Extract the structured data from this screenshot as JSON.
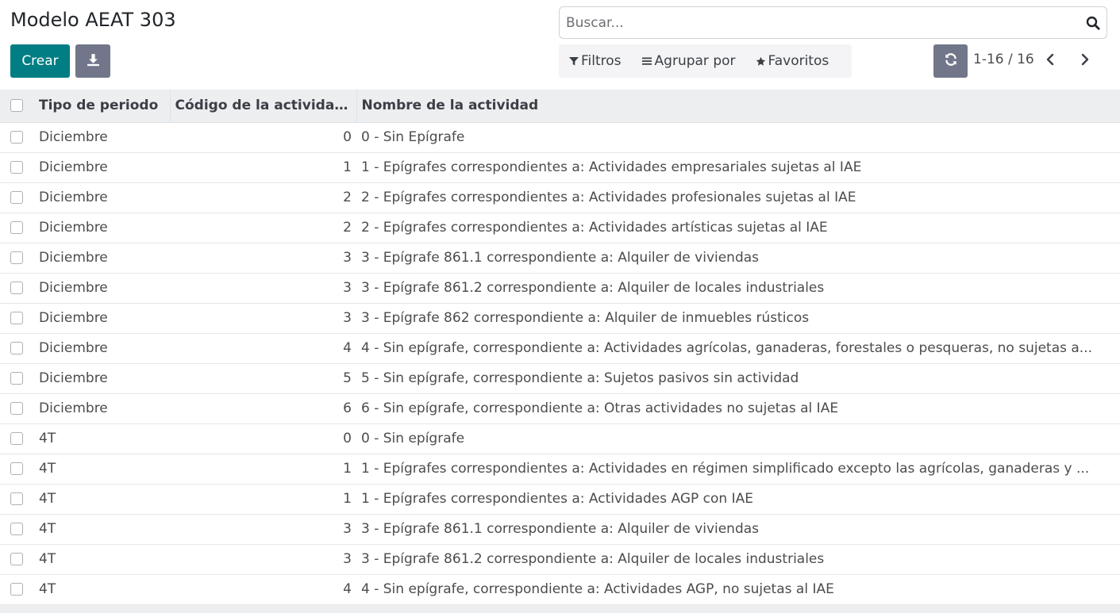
{
  "page": {
    "title": "Modelo AEAT 303"
  },
  "toolbar": {
    "create_label": "Crear",
    "download_icon": "download-icon",
    "refresh_icon": "refresh-icon"
  },
  "search": {
    "placeholder": "Buscar..."
  },
  "filters": {
    "filters_label": "Filtros",
    "group_by_label": "Agrupar por",
    "favorites_label": "Favoritos"
  },
  "pager": {
    "value": "1-16 / 16"
  },
  "colors": {
    "primary": "#017e84",
    "secondary": "#71768a"
  },
  "table": {
    "headers": [
      "Tipo de periodo",
      "Código de la actividad...",
      "Nombre de la actividad"
    ],
    "rows": [
      {
        "tipo": "Diciembre",
        "codigo": "0",
        "nombre": "0 - Sin Epígrafe"
      },
      {
        "tipo": "Diciembre",
        "codigo": "1",
        "nombre": "1 - Epígrafes correspondientes a: Actividades empresariales sujetas al IAE"
      },
      {
        "tipo": "Diciembre",
        "codigo": "2",
        "nombre": "2 - Epígrafes correspondientes a: Actividades profesionales sujetas al IAE"
      },
      {
        "tipo": "Diciembre",
        "codigo": "2",
        "nombre": "2 - Epígrafes correspondientes a: Actividades artísticas sujetas al IAE"
      },
      {
        "tipo": "Diciembre",
        "codigo": "3",
        "nombre": "3 - Epígrafe 861.1 correspondiente a: Alquiler de viviendas"
      },
      {
        "tipo": "Diciembre",
        "codigo": "3",
        "nombre": "3 - Epígrafe 861.2 correspondiente a: Alquiler de locales industriales"
      },
      {
        "tipo": "Diciembre",
        "codigo": "3",
        "nombre": "3 - Epígrafe 862 correspondiente a: Alquiler de inmuebles rústicos"
      },
      {
        "tipo": "Diciembre",
        "codigo": "4",
        "nombre": "4 - Sin epígrafe, correspondiente a: Actividades agrícolas, ganaderas, forestales o pesqueras, no sujetas a..."
      },
      {
        "tipo": "Diciembre",
        "codigo": "5",
        "nombre": "5 - Sin epígrafe, correspondiente a: Sujetos pasivos sin actividad"
      },
      {
        "tipo": "Diciembre",
        "codigo": "6",
        "nombre": "6 - Sin epígrafe, correspondiente a: Otras actividades no sujetas al IAE"
      },
      {
        "tipo": "4T",
        "codigo": "0",
        "nombre": "0 - Sin epígrafe"
      },
      {
        "tipo": "4T",
        "codigo": "1",
        "nombre": "1 - Epígrafes correspondientes a: Actividades en régimen simplificado excepto las agrícolas, ganaderas y ..."
      },
      {
        "tipo": "4T",
        "codigo": "1",
        "nombre": "1 - Epígrafes correspondientes a: Actividades AGP con IAE"
      },
      {
        "tipo": "4T",
        "codigo": "3",
        "nombre": "3 - Epígrafe 861.1 correspondiente a: Alquiler de viviendas"
      },
      {
        "tipo": "4T",
        "codigo": "3",
        "nombre": "3 - Epígrafe 861.2 correspondiente a: Alquiler de locales industriales"
      },
      {
        "tipo": "4T",
        "codigo": "4",
        "nombre": "4 - Sin epígrafe, correspondiente a: Actividades AGP, no sujetas al IAE"
      }
    ]
  }
}
